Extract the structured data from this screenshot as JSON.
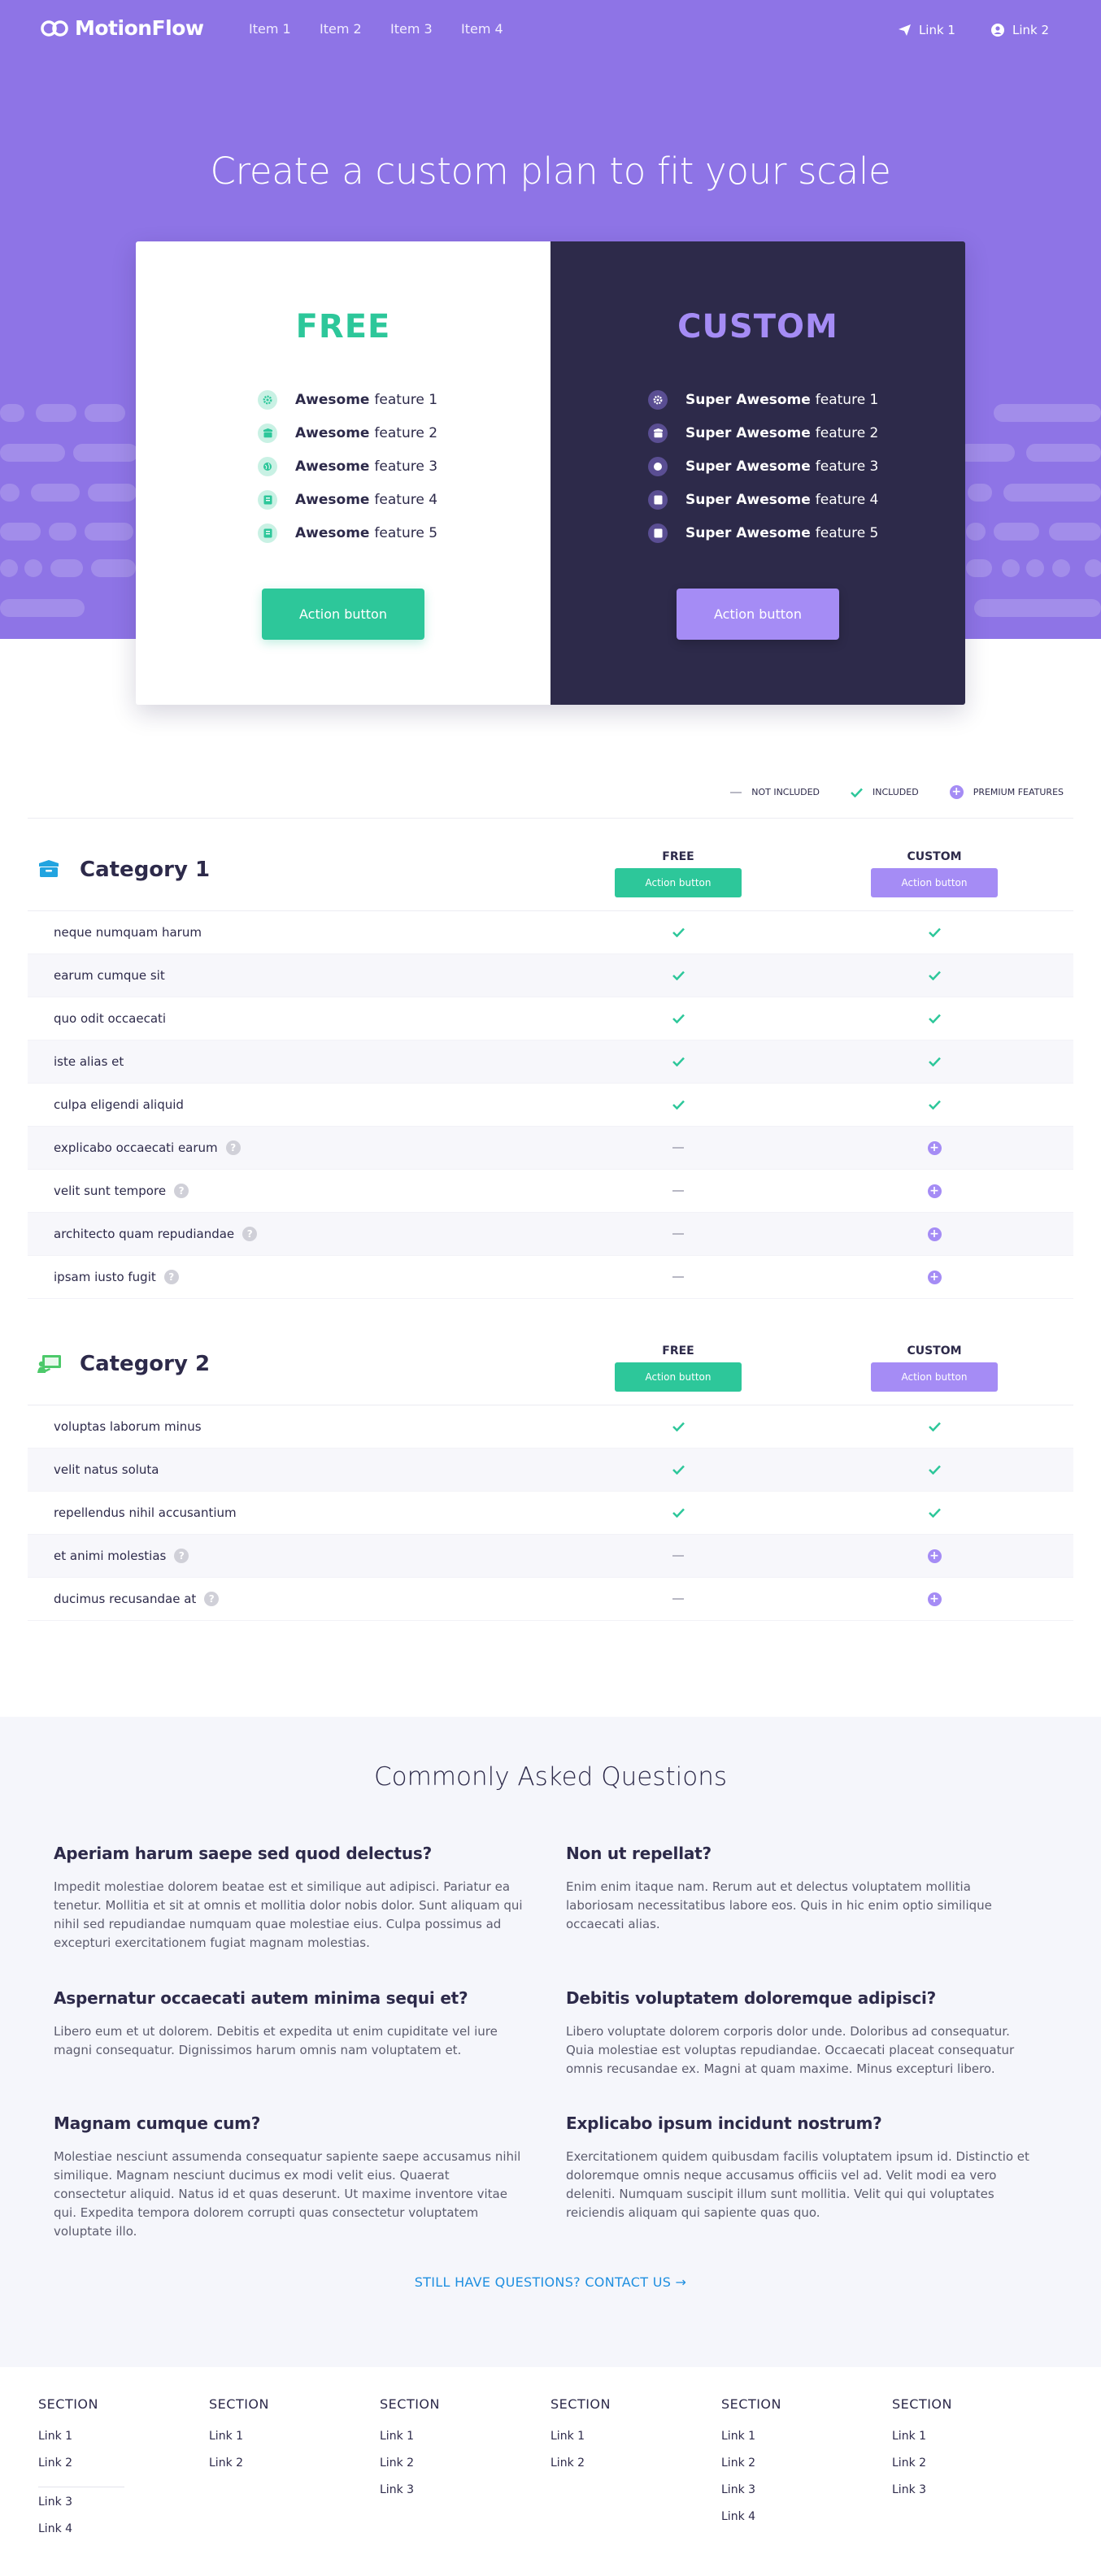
{
  "nav": {
    "brand": "MotionFlow",
    "items": [
      "Item 1",
      "Item 2",
      "Item 3",
      "Item 4"
    ],
    "right_links": [
      {
        "label": "Link 1",
        "icon": "send-icon"
      },
      {
        "label": "Link 2",
        "icon": "user-circle-icon"
      }
    ]
  },
  "hero": {
    "title": "Create a custom plan to fit your scale"
  },
  "plans": {
    "free": {
      "title": "FREE",
      "features": [
        {
          "bold": "Awesome",
          "text": "feature 1",
          "icon": "gear-icon"
        },
        {
          "bold": "Awesome",
          "text": "feature 2",
          "icon": "box-icon"
        },
        {
          "bold": "Awesome",
          "text": "feature 3",
          "icon": "globe-icon"
        },
        {
          "bold": "Awesome",
          "text": "feature 4",
          "icon": "book-icon"
        },
        {
          "bold": "Awesome",
          "text": "feature 5",
          "icon": "book-icon"
        }
      ],
      "button": "Action button"
    },
    "custom": {
      "title": "CUSTOM",
      "features": [
        {
          "bold": "Super Awesome",
          "text": "feature 1",
          "icon": "gear-icon"
        },
        {
          "bold": "Super Awesome",
          "text": "feature 2",
          "icon": "box-icon"
        },
        {
          "bold": "Super Awesome",
          "text": "feature 3",
          "icon": "globe-icon"
        },
        {
          "bold": "Super Awesome",
          "text": "feature 4",
          "icon": "book-icon"
        },
        {
          "bold": "Super Awesome",
          "text": "feature 5",
          "icon": "book-icon"
        }
      ],
      "button": "Action button"
    }
  },
  "legend": {
    "not_included": "Not included",
    "included": "Included",
    "premium": "Premium features"
  },
  "categories": [
    {
      "title": "Category 1",
      "icon": "box-icon",
      "free_label": "FREE",
      "custom_label": "CUSTOM",
      "button": "Action button",
      "rows": [
        {
          "label": "neque numquam harum",
          "help": false,
          "free": "included",
          "custom": "included"
        },
        {
          "label": "earum cumque sit",
          "help": false,
          "free": "included",
          "custom": "included"
        },
        {
          "label": "quo odit occaecati",
          "help": false,
          "free": "included",
          "custom": "included"
        },
        {
          "label": "iste alias et",
          "help": false,
          "free": "included",
          "custom": "included"
        },
        {
          "label": "culpa eligendi aliquid",
          "help": false,
          "free": "included",
          "custom": "included"
        },
        {
          "label": "explicabo occaecati earum",
          "help": true,
          "free": "not_included",
          "custom": "premium"
        },
        {
          "label": "velit sunt tempore",
          "help": true,
          "free": "not_included",
          "custom": "premium"
        },
        {
          "label": "architecto quam repudiandae",
          "help": true,
          "free": "not_included",
          "custom": "premium"
        },
        {
          "label": "ipsam iusto fugit",
          "help": true,
          "free": "not_included",
          "custom": "premium"
        }
      ]
    },
    {
      "title": "Category 2",
      "icon": "presentation-icon",
      "free_label": "FREE",
      "custom_label": "CUSTOM",
      "button": "Action button",
      "rows": [
        {
          "label": "voluptas laborum minus",
          "help": false,
          "free": "included",
          "custom": "included"
        },
        {
          "label": "velit natus soluta",
          "help": false,
          "free": "included",
          "custom": "included"
        },
        {
          "label": "repellendus nihil accusantium",
          "help": false,
          "free": "included",
          "custom": "included"
        },
        {
          "label": "et animi molestias",
          "help": true,
          "free": "not_included",
          "custom": "premium"
        },
        {
          "label": "ducimus recusandae at",
          "help": true,
          "free": "not_included",
          "custom": "premium"
        }
      ]
    }
  ],
  "faq": {
    "title": "Commonly Asked Questions",
    "items": [
      {
        "q": "Aperiam harum saepe sed quod delectus?",
        "a": "Impedit molestiae dolorem beatae est et similique aut adipisci. Pariatur ea tenetur. Mollitia et sit at omnis et mollitia dolor nobis dolor. Sunt aliquam qui nihil sed repudiandae numquam quae molestiae eius. Culpa possimus ad excepturi exercitationem fugiat magnam molestias."
      },
      {
        "q": "Non ut repellat?",
        "a": "Enim enim itaque nam. Rerum aut et delectus voluptatem mollitia laboriosam necessitatibus labore eos. Quis in hic enim optio similique occaecati alias."
      },
      {
        "q": "Aspernatur occaecati autem minima sequi et?",
        "a": "Libero eum et ut dolorem. Debitis et expedita ut enim cupiditate vel iure magni consequatur. Dignissimos harum omnis nam voluptatem et."
      },
      {
        "q": "Debitis voluptatem doloremque adipisci?",
        "a": "Libero voluptate dolorem corporis dolor unde. Doloribus ad consequatur. Quia molestiae est voluptas repudiandae. Occaecati placeat consequatur omnis recusandae ex. Magni at quam maxime. Minus excepturi libero."
      },
      {
        "q": "Magnam cumque cum?",
        "a": "Molestiae nesciunt assumenda consequatur sapiente saepe accusamus nihil similique. Magnam nesciunt ducimus ex modi velit eius. Quaerat consectetur aliquid. Natus id et quas deserunt. Ut maxime inventore vitae qui. Expedita tempora dolorem corrupti quas consectetur voluptatem voluptate illo."
      },
      {
        "q": "Explicabo ipsum incidunt nostrum?",
        "a": "Exercitationem quidem quibusdam facilis voluptatem ipsum id. Distinctio et doloremque omnis neque accusamus officiis vel ad. Velit modi ea vero deleniti. Numquam suscipit illum sunt mollitia. Velit qui qui voluptates reiciendis aliquam qui sapiente quas quo."
      }
    ],
    "contact": "STILL HAVE QUESTIONS? CONTACT US →"
  },
  "footer": {
    "columns": [
      {
        "title": "SECTION",
        "links": [
          "Link 1",
          "Link 2"
        ],
        "extra": [
          "Link 3",
          "Link 4"
        ]
      },
      {
        "title": "SECTION",
        "links": [
          "Link 1",
          "Link 2"
        ]
      },
      {
        "title": "SECTION",
        "links": [
          "Link 1",
          "Link 2",
          "Link 3"
        ]
      },
      {
        "title": "SECTION",
        "links": [
          "Link 1",
          "Link 2"
        ]
      },
      {
        "title": "SECTION",
        "links": [
          "Link 1",
          "Link 2",
          "Link 3",
          "Link 4"
        ]
      },
      {
        "title": "SECTION",
        "links": [
          "Link 1",
          "Link 2",
          "Link 3"
        ]
      }
    ]
  },
  "colors": {
    "hero_bg": "#8e74e6",
    "free_accent": "#2dc79a",
    "custom_accent": "#a58cf5",
    "custom_bg": "#2d2a4a",
    "link_blue": "#1f8fe0"
  }
}
